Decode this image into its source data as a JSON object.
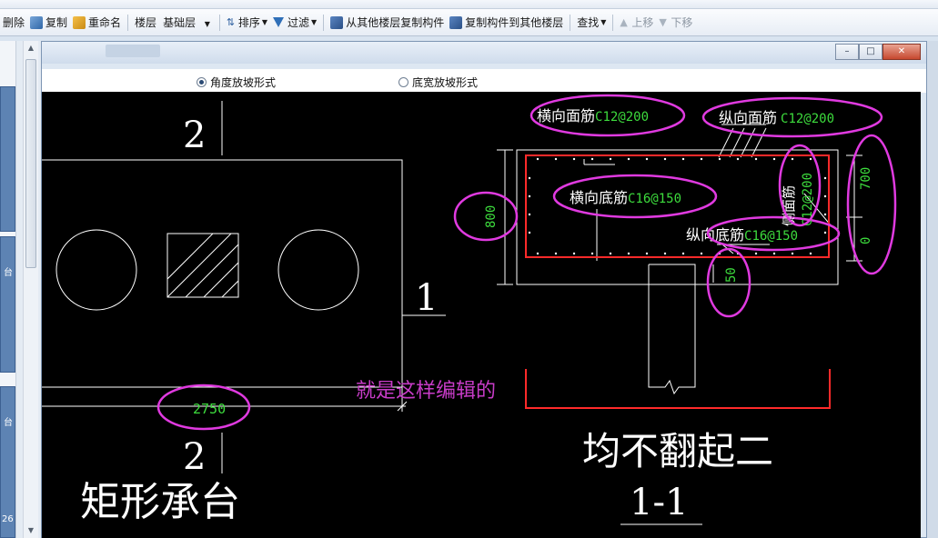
{
  "toolbar": {
    "delete_label": "删除",
    "copy_label": "复制",
    "rename_label": "重命名",
    "floor_label": "楼层",
    "floor_value": "基础层",
    "sort_label": "排序",
    "filter_label": "过滤",
    "copy_from_other_floor_label": "从其他楼层复制构件",
    "copy_to_other_floor_label": "复制构件到其他楼层",
    "find_label": "查找",
    "move_up_label": "上移",
    "move_down_label": "下移"
  },
  "left_panel": {
    "thumb_text_1": "台",
    "thumb_text_2": "台",
    "page_number": "26"
  },
  "dialog": {
    "radio_angle_label": "角度放坡形式",
    "radio_width_label": "底宽放坡形式",
    "radio_selected": "angle"
  },
  "drawing": {
    "section_mark_top": "2",
    "section_mark_bottom": "2",
    "section_mark_right": "1",
    "plan_dimension": "2750",
    "plan_title": "矩形承台",
    "note_text": "就是这样编辑的",
    "transverse_top_label": "横向面筋",
    "transverse_top_value": "C12@200",
    "longitudinal_top_label": "纵向面筋",
    "longitudinal_top_value": "C12@200",
    "transverse_bottom_label": "横向底筋",
    "transverse_bottom_value": "C16@150",
    "longitudinal_bottom_label": "纵向底筋",
    "longitudinal_bottom_value": "C16@150",
    "side_bar_label": "侧面筋",
    "side_bar_value": "C12@200",
    "height_dim": "800",
    "dim_700": "700",
    "dim_0": "0",
    "dim_50": "50",
    "section_caption": "均不翻起二",
    "section_name": "1-1",
    "colors": {
      "white": "#ffffff",
      "green": "#3ddc3d",
      "magenta": "#e03ae0",
      "red": "#ff2a2a"
    }
  }
}
